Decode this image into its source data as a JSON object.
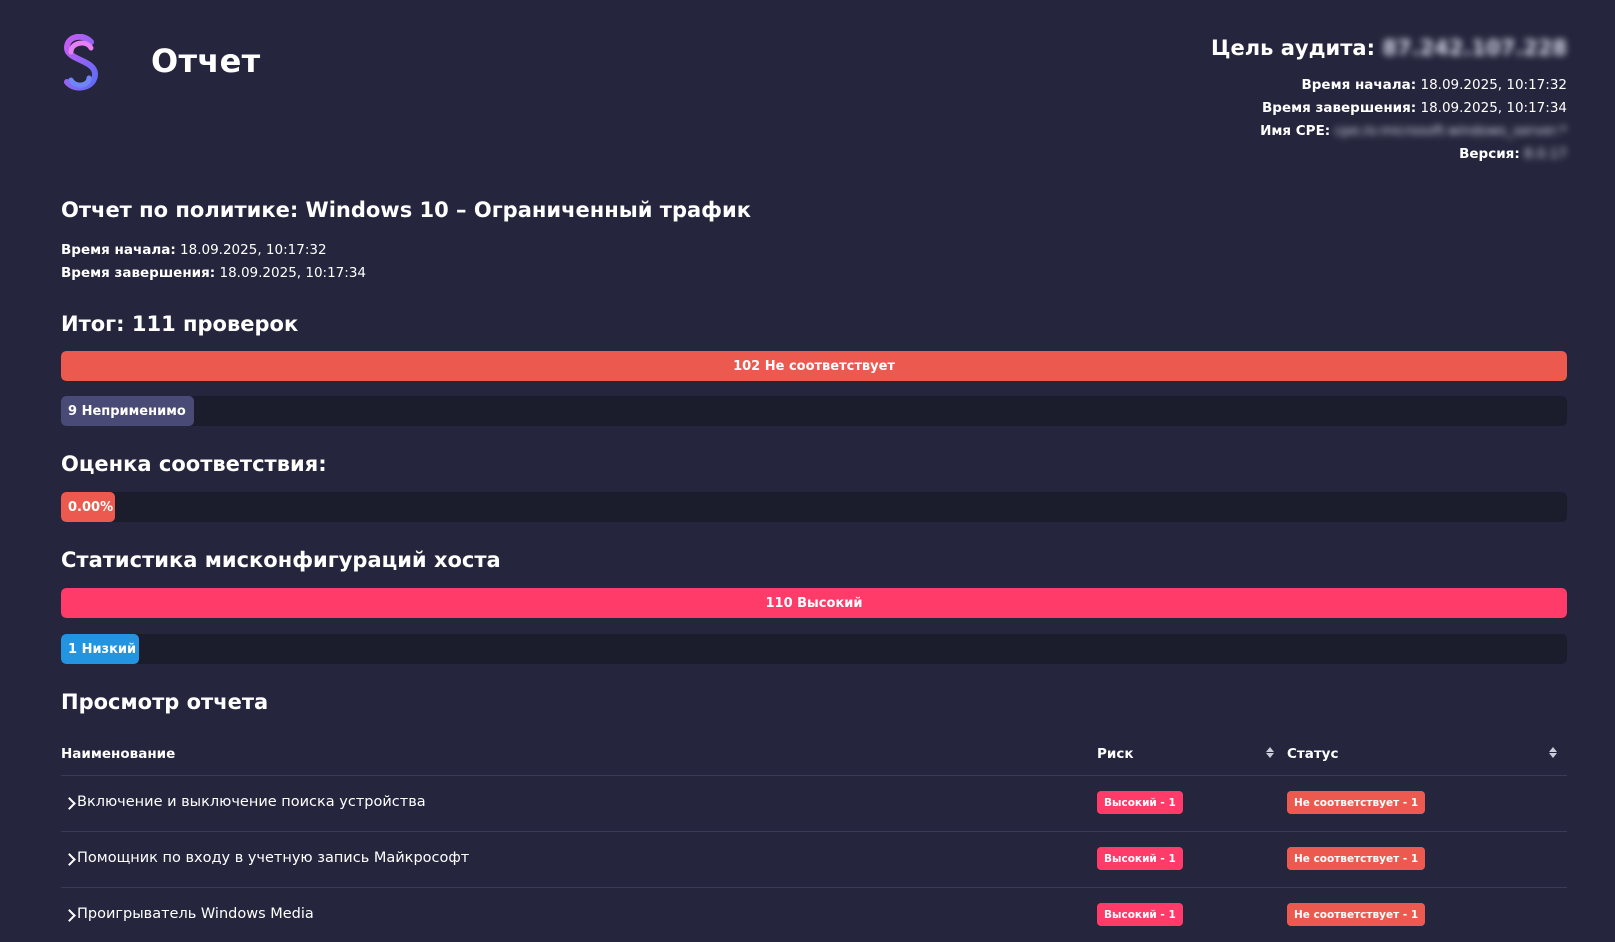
{
  "header": {
    "title": "Отчет",
    "target_label": "Цель аудита:",
    "target_value": "87.242.107.228",
    "start_label": "Время начала:",
    "start_value": "18.09.2025, 10:17:32",
    "end_label": "Время завершения:",
    "end_value": "18.09.2025, 10:17:34",
    "cpe_label": "Имя CPE:",
    "cpe_value": "cpe:/o:microsoft:windows_server:*",
    "version_label": "Версия:",
    "version_value": "8.0.17"
  },
  "policy": {
    "heading": "Отчет по политике: Windows 10 – Ограниченный трафик",
    "start_label": "Время начала:",
    "start_value": "18.09.2025, 10:17:32",
    "end_label": "Время завершения:",
    "end_value": "18.09.2025, 10:17:34"
  },
  "summary": {
    "heading": "Итог: 111 проверок",
    "bars": [
      {
        "label": "102 Не соответствует",
        "fraction": 1.0,
        "color": "#ec5a4f"
      },
      {
        "label": "9 Неприменимо",
        "fraction": 0.088,
        "color": "#4a4a77"
      }
    ]
  },
  "compliance": {
    "heading": "Оценка соответствия:",
    "value_label": "0.00%",
    "color": "#ec5a4f"
  },
  "misconfig": {
    "heading": "Статистика мисконфигураций хоста",
    "bars": [
      {
        "label": "110 Высокий",
        "fraction": 1.0,
        "color": "#ff3b6a"
      },
      {
        "label": "1 Низкий",
        "fraction": 0.052,
        "color": "#2394e0"
      }
    ]
  },
  "report": {
    "heading": "Просмотр отчета",
    "columns": {
      "name": "Наименование",
      "risk": "Риск",
      "status": "Статус"
    },
    "rows": [
      {
        "name": "Включение и выключение поиска устройства",
        "risk": "Высокий - 1",
        "status": "Не соответствует - 1"
      },
      {
        "name": "Помощник по входу в учетную запись Майкрософт",
        "risk": "Высокий - 1",
        "status": "Не соответствует - 1"
      },
      {
        "name": "Проигрыватель Windows Media",
        "risk": "Высокий - 1",
        "status": "Не соответствует - 1"
      }
    ],
    "risk_color": "#ff3b6a",
    "status_color": "#ec5a4f"
  },
  "colors": {
    "background": "#25263d",
    "track": "#1c1d2c"
  },
  "icons": {
    "logo": "brand-logo-icon",
    "expand": "chevron-right-icon",
    "sort": "sort-icon"
  }
}
